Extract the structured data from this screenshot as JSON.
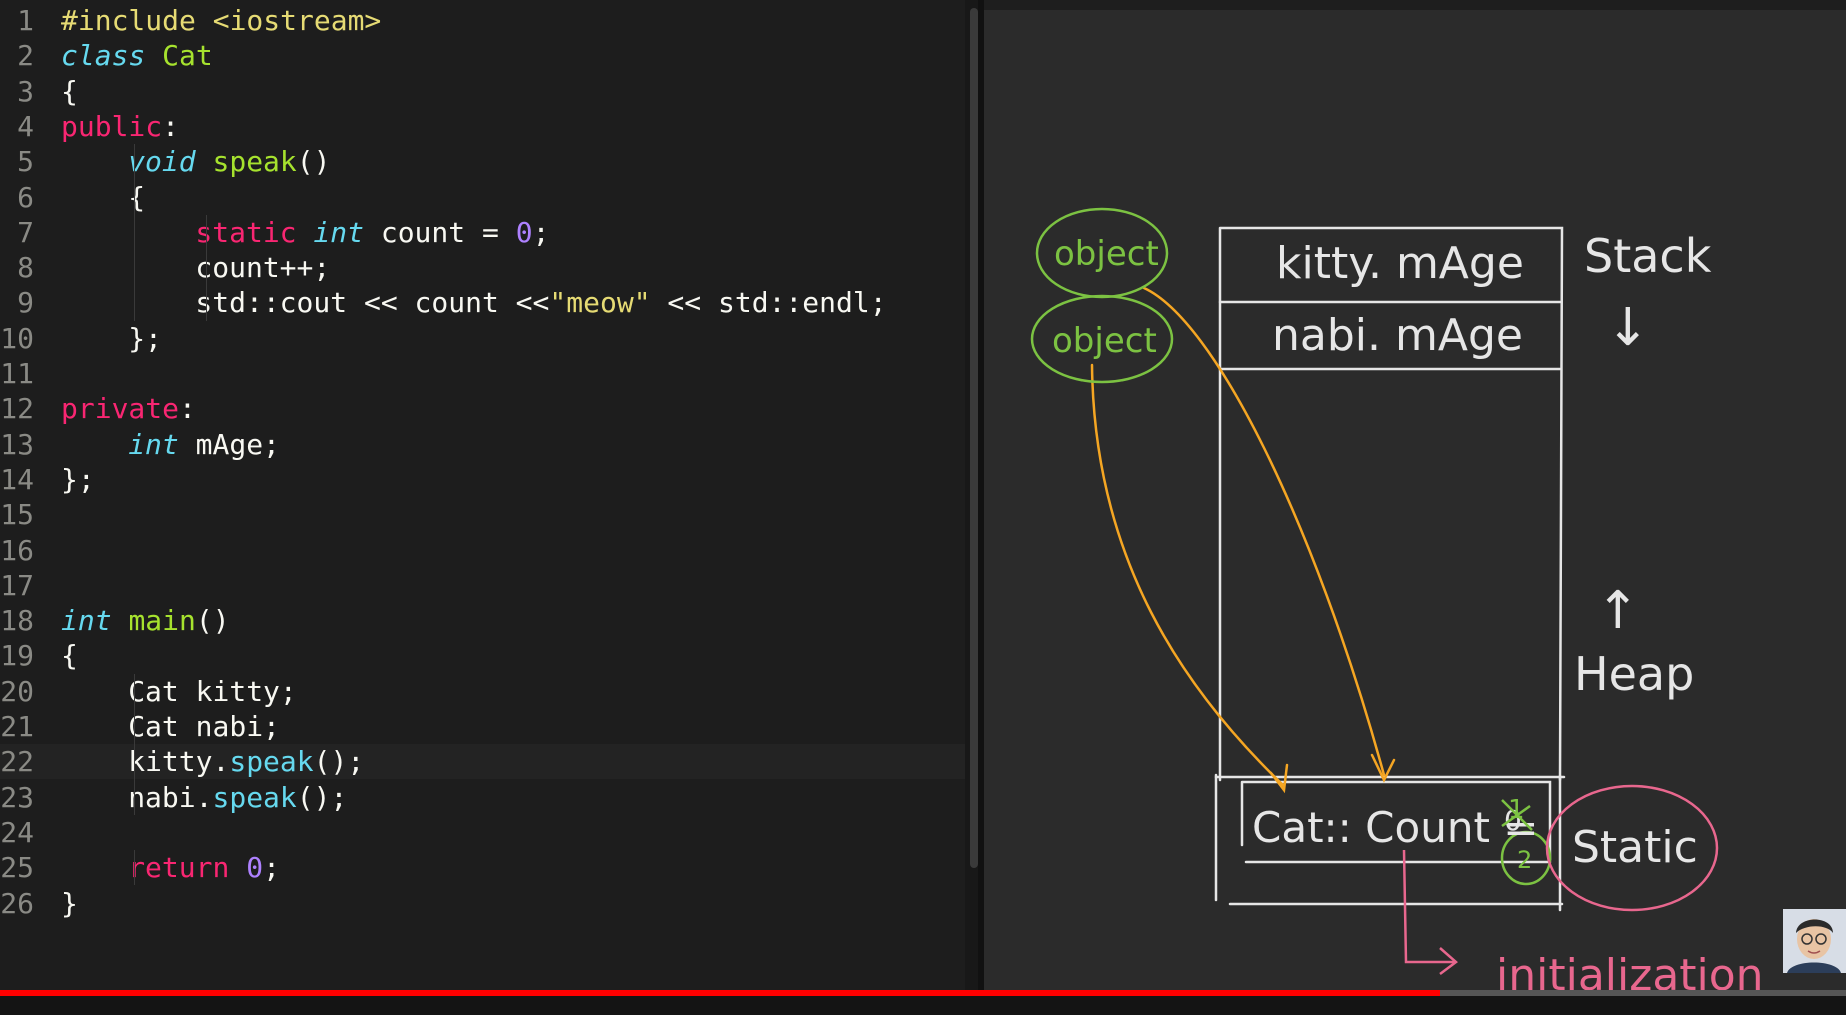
{
  "editor": {
    "line_numbers": [
      "1",
      "2",
      "3",
      "4",
      "5",
      "6",
      "7",
      "8",
      "9",
      "10",
      "11",
      "12",
      "13",
      "14",
      "15",
      "16",
      "17",
      "18",
      "19",
      "20",
      "21",
      "22",
      "23",
      "24",
      "25",
      "26"
    ],
    "current_line": "22",
    "lines": {
      "l1": {
        "a": "#include",
        "b": " <iostream>"
      },
      "l2": {
        "a": "class",
        "b": " ",
        "c": "Cat"
      },
      "l3": {
        "a": "{"
      },
      "l4": {
        "a": "public",
        "b": ":"
      },
      "l5": {
        "a": "void",
        "b": " ",
        "c": "speak",
        "d": "()"
      },
      "l6": {
        "a": "{"
      },
      "l7": {
        "a": "static",
        "b": " ",
        "c": "int",
        "d": " count = ",
        "e": "0",
        "f": ";"
      },
      "l8": {
        "a": "count++;"
      },
      "l9": {
        "a": "std::cout << count <<",
        "b": "\"meow\"",
        "c": " << std::endl;"
      },
      "l10": {
        "a": "};"
      },
      "l12": {
        "a": "private",
        "b": ":"
      },
      "l13": {
        "a": "int",
        "b": " mAge;"
      },
      "l14": {
        "a": "};"
      },
      "l18": {
        "a": "int",
        "b": " ",
        "c": "main",
        "d": "()"
      },
      "l19": {
        "a": "{"
      },
      "l20": {
        "a": "Cat kitty;"
      },
      "l21": {
        "a": "Cat nabi;"
      },
      "l22": {
        "a": "kitty.",
        "b": "speak",
        "c": "();"
      },
      "l23": {
        "a": "nabi.",
        "b": "speak",
        "c": "();"
      },
      "l25": {
        "a": "return",
        "b": " ",
        "c": "0",
        "d": ";"
      },
      "l26": {
        "a": "}"
      }
    }
  },
  "whiteboard": {
    "object_label_1": "object",
    "object_label_2": "object",
    "stack_slot_1": "kitty. mAge",
    "stack_slot_2": "nabi. mAge",
    "stack_label": "Stack",
    "stack_arrow": "↓",
    "heap_arrow": "↑",
    "heap_label": "Heap",
    "static_slot": "Cat:: Count =",
    "count_values": [
      "0",
      "1",
      "2"
    ],
    "static_label": "Static",
    "initialization_label": "initialization",
    "colors": {
      "green": "#7cc242",
      "orange": "#f5a623",
      "pink": "#e8678e",
      "white": "#e6e6e6"
    }
  },
  "video": {
    "progress_fraction": 0.78,
    "avatar": "presenter-avatar"
  }
}
